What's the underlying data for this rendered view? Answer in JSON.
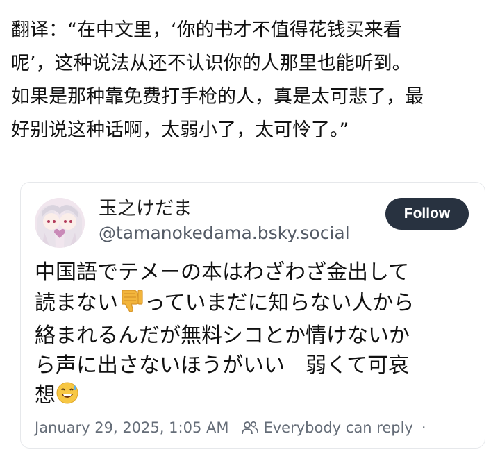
{
  "caption": {
    "lines": [
      "翻译：“在中文里，‘你的书才不值得花钱买来看",
      "呢’，这种说法从还不认识你的人那里也能听到。",
      "如果是那种靠免费打手枪的人，真是太可悲了，最",
      "好别说这种话啊，太弱小了，太可怜了。”"
    ]
  },
  "post": {
    "display_name": "玉之けだま",
    "handle": "@tamanokedama.bsky.social",
    "follow_label": "Follow",
    "body": {
      "line1": "中国語でテメーの本はわざわざ金出して",
      "line2_a": "読まない",
      "line2_b": "っていまだに知らない人から",
      "line3": "絡まれるんだが無料シコとか情けないか",
      "line4": "ら声に出さないほうがいい　弱くて可哀",
      "line5": "想"
    },
    "emojis": {
      "thumbs_down": "thumbs-down-icon",
      "sweat_smile": "sweat-smile-icon"
    },
    "timestamp": "January 29, 2025, 1:05 AM",
    "reply_setting": "Everybody can reply",
    "more_dot": "·"
  },
  "colors": {
    "follow_button_bg": "#283240",
    "secondary_text": "#656d78",
    "handle_text": "#545b66",
    "card_border": "#e6e8eb"
  }
}
